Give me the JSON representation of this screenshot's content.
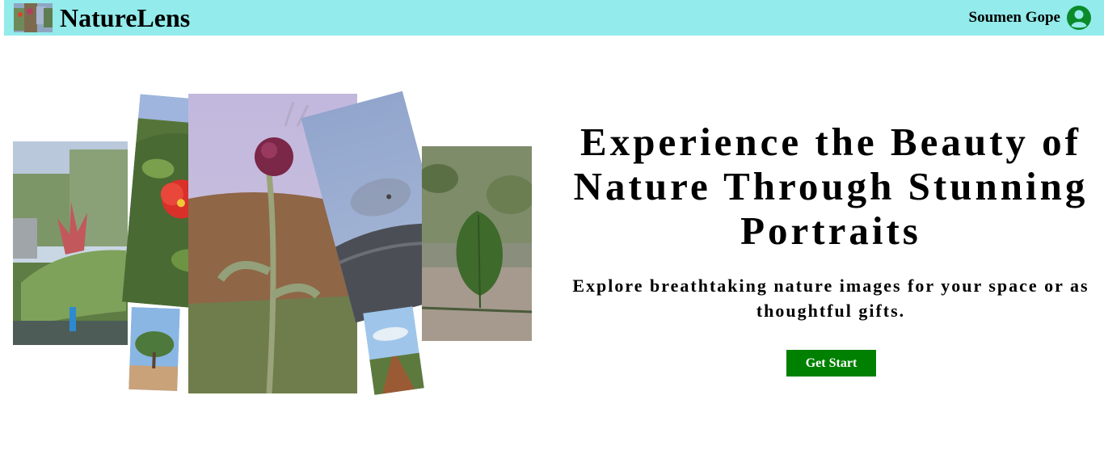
{
  "header": {
    "brand": "NatureLens",
    "user_name": "Soumen Gope",
    "logo_icon": "collage-logo-icon",
    "user_icon": "user-circle-icon"
  },
  "hero": {
    "title": "Experience the Beauty of Nature Through Stunning Portraits",
    "subtitle": "Explore breathtaking nature images for your space or as thoughtful gifts.",
    "cta_label": "Get Start"
  },
  "collage": {
    "photos": [
      {
        "name": "succulent-flower-photo"
      },
      {
        "name": "red-hibiscus-photo"
      },
      {
        "name": "purple-thistle-photo"
      },
      {
        "name": "sky-moon-photo"
      },
      {
        "name": "green-leaf-photo"
      },
      {
        "name": "lone-tree-photo"
      },
      {
        "name": "dirt-road-photo"
      }
    ]
  },
  "colors": {
    "header_bg": "#93ebeb",
    "accent": "#008000",
    "text": "#000000"
  }
}
